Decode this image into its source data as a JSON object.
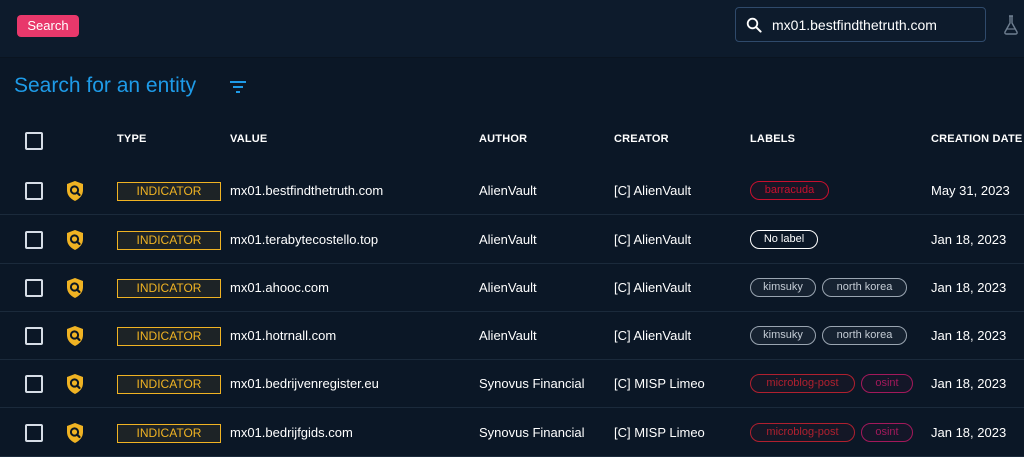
{
  "toolbar": {
    "search_button_label": "Search",
    "search_value": "mx01.bestfindthetruth.com"
  },
  "icons": {
    "search": "magnifier-icon",
    "flask": "flask-icon",
    "filter": "filter-icon",
    "entity": "indicator-shield-icon"
  },
  "page": {
    "title": "Search for an entity"
  },
  "table": {
    "columns": {
      "type": "TYPE",
      "value": "VALUE",
      "author": "AUTHOR",
      "creator": "CREATOR",
      "labels": "LABELS",
      "creation_date": "CREATION DATE"
    },
    "rows": [
      {
        "type": "INDICATOR",
        "value": "mx01.bestfindthetruth.com",
        "author": "AlienVault",
        "creator": "[C] AlienVault",
        "labels": [
          {
            "text": "barracuda",
            "style": "red"
          }
        ],
        "creation_date": "May 31, 2023"
      },
      {
        "type": "INDICATOR",
        "value": "mx01.terabytecostello.top",
        "author": "AlienVault",
        "creator": "[C] AlienVault",
        "labels": [
          {
            "text": "No label",
            "style": "none"
          }
        ],
        "creation_date": "Jan 18, 2023"
      },
      {
        "type": "INDICATOR",
        "value": "mx01.ahooc.com",
        "author": "AlienVault",
        "creator": "[C] AlienVault",
        "labels": [
          {
            "text": "kimsuky",
            "style": "grey"
          },
          {
            "text": "north korea",
            "style": "grey"
          }
        ],
        "creation_date": "Jan 18, 2023"
      },
      {
        "type": "INDICATOR",
        "value": "mx01.hotrnall.com",
        "author": "AlienVault",
        "creator": "[C] AlienVault",
        "labels": [
          {
            "text": "kimsuky",
            "style": "grey"
          },
          {
            "text": "north korea",
            "style": "grey"
          }
        ],
        "creation_date": "Jan 18, 2023"
      },
      {
        "type": "INDICATOR",
        "value": "mx01.bedrijvenregister.eu",
        "author": "Synovus Financial",
        "creator": "[C] MISP Limeo",
        "labels": [
          {
            "text": "microblog-post",
            "style": "darkred"
          },
          {
            "text": "osint",
            "style": "magenta"
          }
        ],
        "creation_date": "Jan 18, 2023"
      },
      {
        "type": "INDICATOR",
        "value": "mx01.bedrijfgids.com",
        "author": "Synovus Financial",
        "creator": "[C] MISP Limeo",
        "labels": [
          {
            "text": "microblog-post",
            "style": "darkred"
          },
          {
            "text": "osint",
            "style": "magenta"
          }
        ],
        "creation_date": "Jan 18, 2023"
      }
    ]
  },
  "colors": {
    "background": "#0b1726",
    "topbar": "#0d1b2c",
    "accent_pink": "#e8386b",
    "title_blue": "#1e9be8",
    "indicator_yellow": "#f0b323",
    "label_red": "#c8102e",
    "label_grey": "#9aa5b1",
    "label_darkred": "#b0202f",
    "label_magenta": "#a3195b"
  }
}
